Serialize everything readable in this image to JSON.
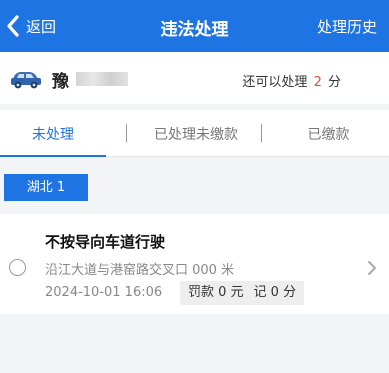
{
  "header": {
    "back_label": "返回",
    "title": "违法处理",
    "history_label": "处理历史",
    "bg_color": "#1f74e3"
  },
  "vehicle": {
    "icon": "car-icon",
    "plate_prefix": "豫",
    "quota_prefix": "还可以处理",
    "quota_count": "2",
    "quota_unit": "分"
  },
  "tabs": [
    {
      "label": "未处理",
      "active": true
    },
    {
      "label": "已处理未缴款",
      "active": false
    },
    {
      "label": "已缴款",
      "active": false
    }
  ],
  "region": {
    "label": "湖北 1"
  },
  "record": {
    "title": "不按导向车道行驶",
    "location": "沿江大道与港窑路交叉口 000 米",
    "time": "2024-10-01 16:06",
    "fine_label": "罚款 0 元",
    "points_label": "记 0 分"
  },
  "colors": {
    "accent": "#1f74e3",
    "highlight": "#e04b3a"
  }
}
